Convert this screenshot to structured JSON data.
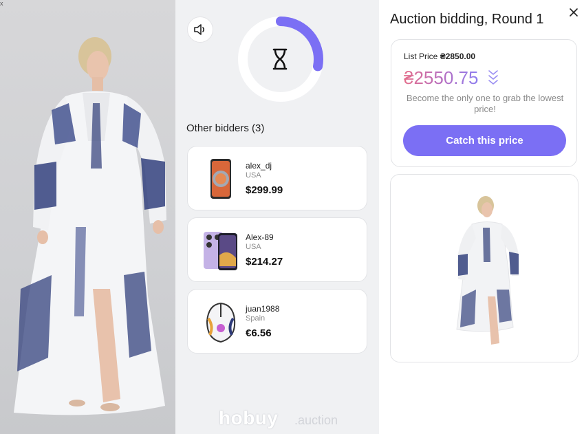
{
  "auction": {
    "title": "Auction bidding, Round 1",
    "list_price_label": "List Price",
    "list_price": "₴2850.00",
    "current_price": "₴2550.75",
    "promo": "Become the only one to grab the lowest price!",
    "cta": "Catch this price"
  },
  "bidders": {
    "title": "Other bidders (3)",
    "items": [
      {
        "user": "alex_dj",
        "country": "USA",
        "price": "$299.99",
        "thumb": "phone-orange-icon"
      },
      {
        "user": "Alex-89",
        "country": "USA",
        "price": "$214.27",
        "thumb": "phone-purple-icon"
      },
      {
        "user": "juan1988",
        "country": "Spain",
        "price": "€6.56",
        "thumb": "gaming-mouse-icon"
      }
    ]
  },
  "timer": {
    "progress": 0.28,
    "icon": "hourglass-icon"
  },
  "brand": {
    "name": "hobuy",
    "suffix": ".auction"
  },
  "corner_mark": "x",
  "icons": {
    "sound": "speaker-icon",
    "close": "close-icon",
    "price_trend": "chevrons-down-icon"
  },
  "colors": {
    "accent": "#7b6ff4",
    "price_gradient_start": "#e46e8c",
    "price_gradient_end": "#8e7ef0",
    "panel_bg": "#f0f1f3"
  }
}
